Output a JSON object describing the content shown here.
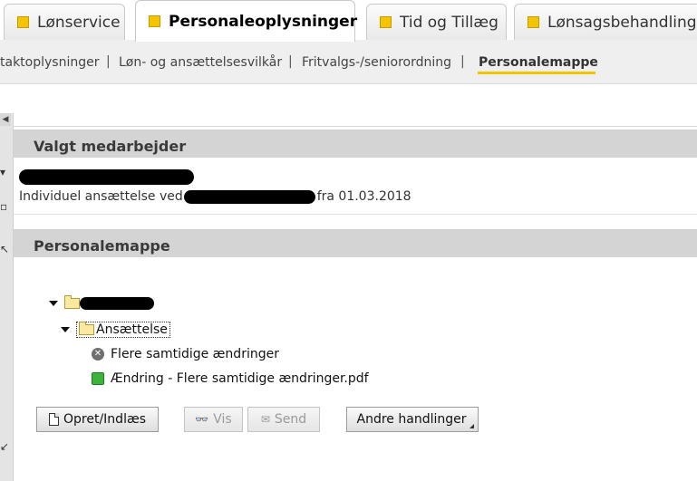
{
  "tabs": [
    {
      "label": "Lønservice",
      "active": false
    },
    {
      "label": "Personaleoplysninger",
      "active": true
    },
    {
      "label": "Tid og Tillæg",
      "active": false
    },
    {
      "label": "Lønsagsbehandling",
      "active": false
    }
  ],
  "subnav": {
    "items": [
      {
        "label": "taktoplysninger"
      },
      {
        "label": "Løn- og ansættelsesvilkår"
      },
      {
        "label": "Fritvalgs-/seniorordning"
      },
      {
        "label": "Personalemappe",
        "active": true
      }
    ],
    "separator": "|"
  },
  "employee_panel": {
    "title": "Valgt medarbejder",
    "employment_prefix": "Individuel ansættelse ved",
    "employment_suffix": "fra 01.03.2018"
  },
  "folder_panel": {
    "title": "Personalemappe",
    "tree": {
      "subfolder": "Ansættelse",
      "items": [
        {
          "label": "Flere samtidige ændringer",
          "icon": "cancelled-x-icon"
        },
        {
          "label": "Ændring - Flere samtidige ændringer.pdf",
          "icon": "green-status-icon"
        }
      ]
    }
  },
  "buttons": {
    "create": "Opret/Indlæs",
    "view": "Vis",
    "send": "Send",
    "other_actions": "Andre handlinger"
  },
  "colors": {
    "tab_marker": "#f4c400",
    "panel_header": "#d4d4d4",
    "active_underline": "#f4c400"
  }
}
